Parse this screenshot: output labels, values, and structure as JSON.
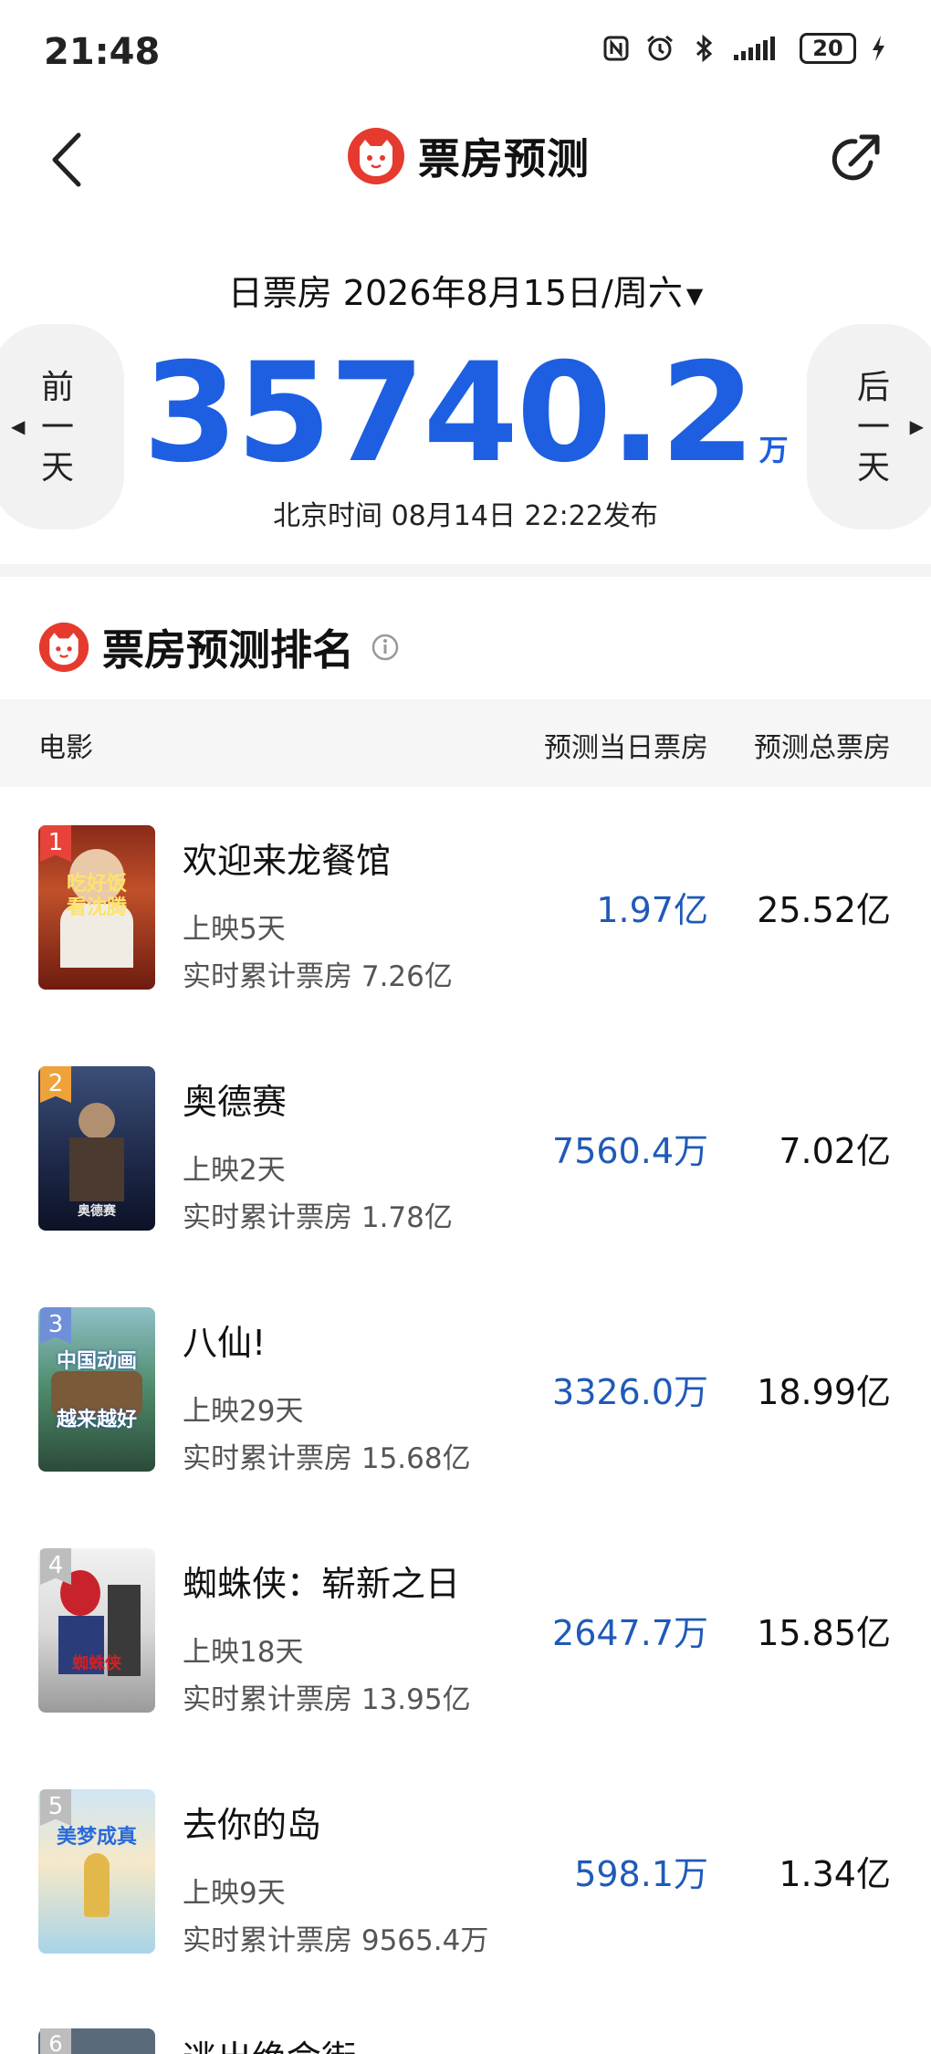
{
  "status": {
    "time": "21:48",
    "battery": "20"
  },
  "header": {
    "title": "票房预测"
  },
  "summary": {
    "date_label": "日票房 2026年8月15日/周六",
    "prev_label": "前一天",
    "next_label": "后一天",
    "value": "35740.2",
    "unit": "万",
    "publish": "北京时间 08月14日 22:22发布"
  },
  "ranking": {
    "title": "票房预测排名",
    "col_movie": "电影",
    "col_day": "预测当日票房",
    "col_total": "预测总票房",
    "rows": [
      {
        "rank": "1",
        "name": "欢迎来龙餐馆",
        "days": "上映5天",
        "cum": "实时累计票房 7.26亿",
        "day": "1.97亿",
        "total": "25.52亿"
      },
      {
        "rank": "2",
        "name": "奥德赛",
        "days": "上映2天",
        "cum": "实时累计票房 1.78亿",
        "day": "7560.4万",
        "total": "7.02亿"
      },
      {
        "rank": "3",
        "name": "八仙!",
        "days": "上映29天",
        "cum": "实时累计票房 15.68亿",
        "day": "3326.0万",
        "total": "18.99亿"
      },
      {
        "rank": "4",
        "name": "蜘蛛侠：崭新之日",
        "days": "上映18天",
        "cum": "实时累计票房 13.95亿",
        "day": "2647.7万",
        "total": "15.85亿"
      },
      {
        "rank": "5",
        "name": "去你的岛",
        "days": "上映9天",
        "cum": "实时累计票房 9565.4万",
        "day": "598.1万",
        "total": "1.34亿"
      }
    ],
    "next_row_partial": {
      "rank": "6",
      "name": "逃出绝命街"
    }
  },
  "posters": {
    "p1_text": "吃好饭 看沈腾",
    "p2_text": "奥德赛",
    "p3_text": "中国动画 越来越好",
    "p4_text": "蜘蛛侠",
    "p5_text": "美梦成真"
  },
  "colors": {
    "accent_blue": "#1d5fe0",
    "value_blue": "#1f5ab8",
    "brand_red": "#e63a2e"
  }
}
